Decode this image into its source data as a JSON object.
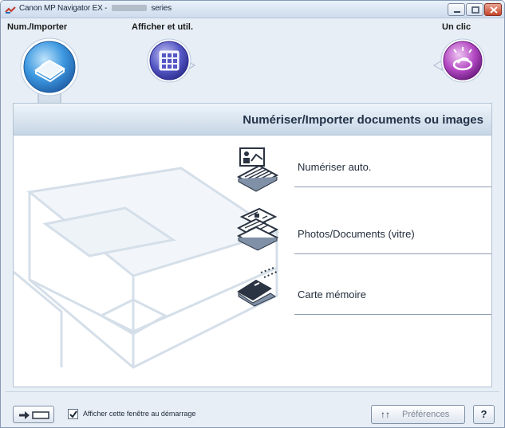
{
  "window": {
    "title_prefix": "Canon MP Navigator EX - ",
    "title_suffix": " series"
  },
  "tabs": [
    {
      "label": "Num./Importer",
      "active": true
    },
    {
      "label": "Afficher et util.",
      "active": false
    },
    {
      "label": "Un clic",
      "active": false
    }
  ],
  "panel": {
    "title": "Numériser/Importer documents ou images",
    "actions": [
      {
        "label": "Numériser auto.",
        "icon": "auto-scan-icon"
      },
      {
        "label": "Photos/Documents (vitre)",
        "icon": "photos-documents-icon"
      },
      {
        "label": "Carte mémoire",
        "icon": "memory-card-icon"
      }
    ]
  },
  "footer": {
    "show_on_startup_label": "Afficher cette fenêtre au démarrage",
    "show_on_startup_checked": true,
    "preferences_label": "Préférences",
    "preferences_icon": "↑↑",
    "help_label": "?"
  },
  "colors": {
    "accent_blue": "#2a7fcf",
    "view_purple": "#4f4fb8",
    "oneclick_purple": "#a83ab6"
  }
}
